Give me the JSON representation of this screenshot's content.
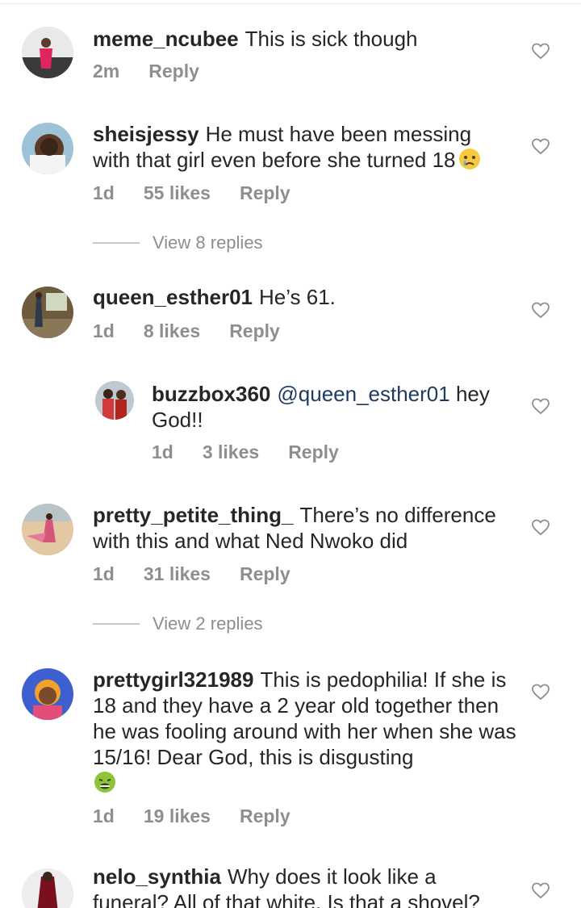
{
  "comments": [
    {
      "username": "meme_ncubee",
      "text": "This is sick though",
      "time": "2m",
      "likes": "",
      "reply": "Reply"
    },
    {
      "username": "sheisjessy",
      "text": "He must have been messing with that girl even before she turned 18",
      "emoji": "crying-face-emoji",
      "time": "1d",
      "likes": "55 likes",
      "reply": "Reply",
      "view_replies": "View 8 replies"
    },
    {
      "username": "queen_esther01",
      "text": "He’s 61.",
      "time": "1d",
      "likes": "8 likes",
      "reply": "Reply"
    },
    {
      "username": "buzzbox360",
      "mention": "@queen_esther01",
      "text": " hey God!!",
      "time": "1d",
      "likes": "3 likes",
      "reply": "Reply"
    },
    {
      "username": "pretty_petite_thing_",
      "text": "There’s no difference with this and what Ned Nwoko did",
      "time": "1d",
      "likes": "31 likes",
      "reply": "Reply",
      "view_replies": "View 2 replies"
    },
    {
      "username": "prettygirl321989",
      "text": "This is pedophilia! If she is 18 and they have a 2 year old together then he was fooling around with her when she was 15/16! Dear God, this is disgusting",
      "emoji": "nauseated-face-emoji",
      "time": "1d",
      "likes": "19 likes",
      "reply": "Reply"
    },
    {
      "username": "nelo_synthia",
      "text": "Why does it look like a funeral? All of that white. Is that a shovel?"
    }
  ],
  "colors": {
    "text": "#262626",
    "meta": "#8e8e8e",
    "mention": "#1e3a5f"
  }
}
